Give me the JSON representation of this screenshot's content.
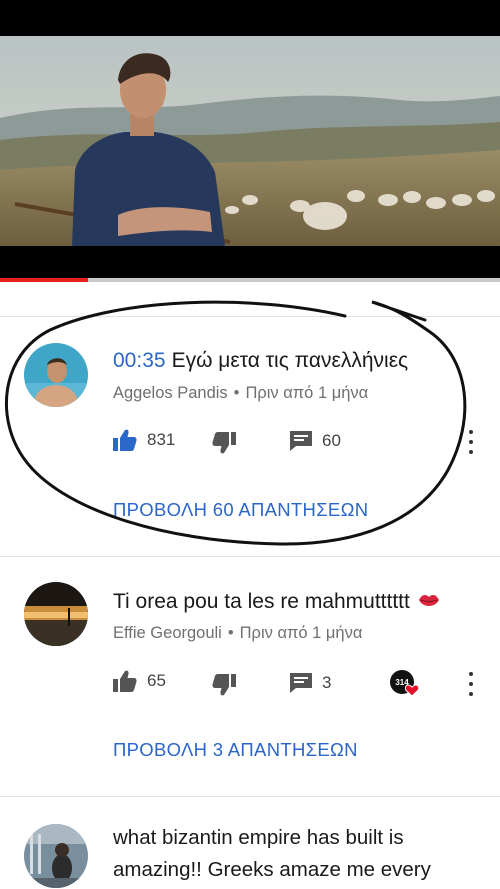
{
  "video": {
    "progress_fraction": 0.175
  },
  "comments": [
    {
      "timestamp": "00:35",
      "text": "Εγώ μετα τις πανελλήνιες",
      "author": "Aggelos Pandis",
      "separator": "•",
      "time_ago": "Πριν από 1 μήνα",
      "likes": "831",
      "replies": "60",
      "liked": true,
      "view_replies": "ΠΡΟΒΟΛΗ 60 ΑΠΑΝΤΗΣΕΩΝ"
    },
    {
      "text": "Ti orea pou ta les re mahmutttttt",
      "author": "Effie Georgouli",
      "separator": "•",
      "time_ago": "Πριν από 1 μήνα",
      "likes": "65",
      "replies": "3",
      "creator_badge": "314",
      "view_replies": "ΠΡΟΒΟΛΗ 3 ΑΠΑΝΤΗΣΕΩΝ"
    },
    {
      "text_line1": "what bizantin empire has built is",
      "text_line2": "amazing!! Greeks amaze me every"
    }
  ],
  "colors": {
    "link": "#2b66c9",
    "progress": "#e62117",
    "like_active": "#2b66c9"
  }
}
